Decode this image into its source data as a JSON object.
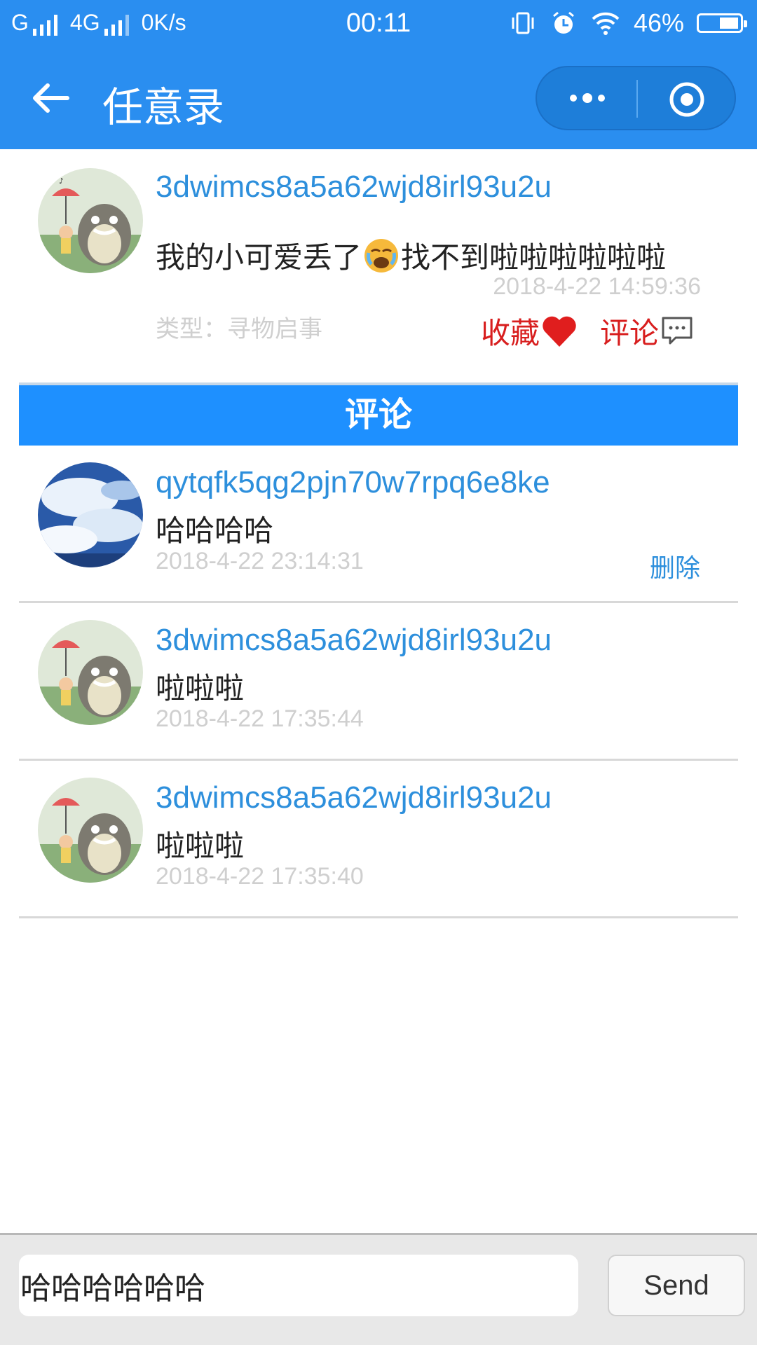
{
  "status_bar": {
    "carrier1": "G",
    "carrier2": "4G",
    "speed": "0K/s",
    "time": "00:11",
    "battery": "46%"
  },
  "nav": {
    "title": "任意录"
  },
  "post": {
    "username": "3dwimcs8a5a62wjd8irl93u2u",
    "content_before": "我的小可爱丢了",
    "content_after": "找不到啦啦啦啦啦啦",
    "time": "2018-4-22 14:59:36",
    "type_label": "类型：寻物启事",
    "favorite_label": "收藏",
    "comment_label": "评论"
  },
  "comments_header": "评论",
  "comments": [
    {
      "username": "qytqfk5qg2pjn70w7rpq6e8ke",
      "text": "哈哈哈哈",
      "time": "2018-4-22 23:14:31",
      "delete_label": "删除"
    },
    {
      "username": "3dwimcs8a5a62wjd8irl93u2u",
      "text": "啦啦啦",
      "time": "2018-4-22 17:35:44"
    },
    {
      "username": "3dwimcs8a5a62wjd8irl93u2u",
      "text": "啦啦啦",
      "time": "2018-4-22 17:35:40"
    }
  ],
  "composer": {
    "input_value": "哈哈哈哈哈哈",
    "send_label": "Send"
  },
  "colors": {
    "brand_blue": "#2a8ef0",
    "section_blue": "#1e90ff",
    "link_blue": "#2d8fdc",
    "accent_red": "#d81e1e"
  }
}
